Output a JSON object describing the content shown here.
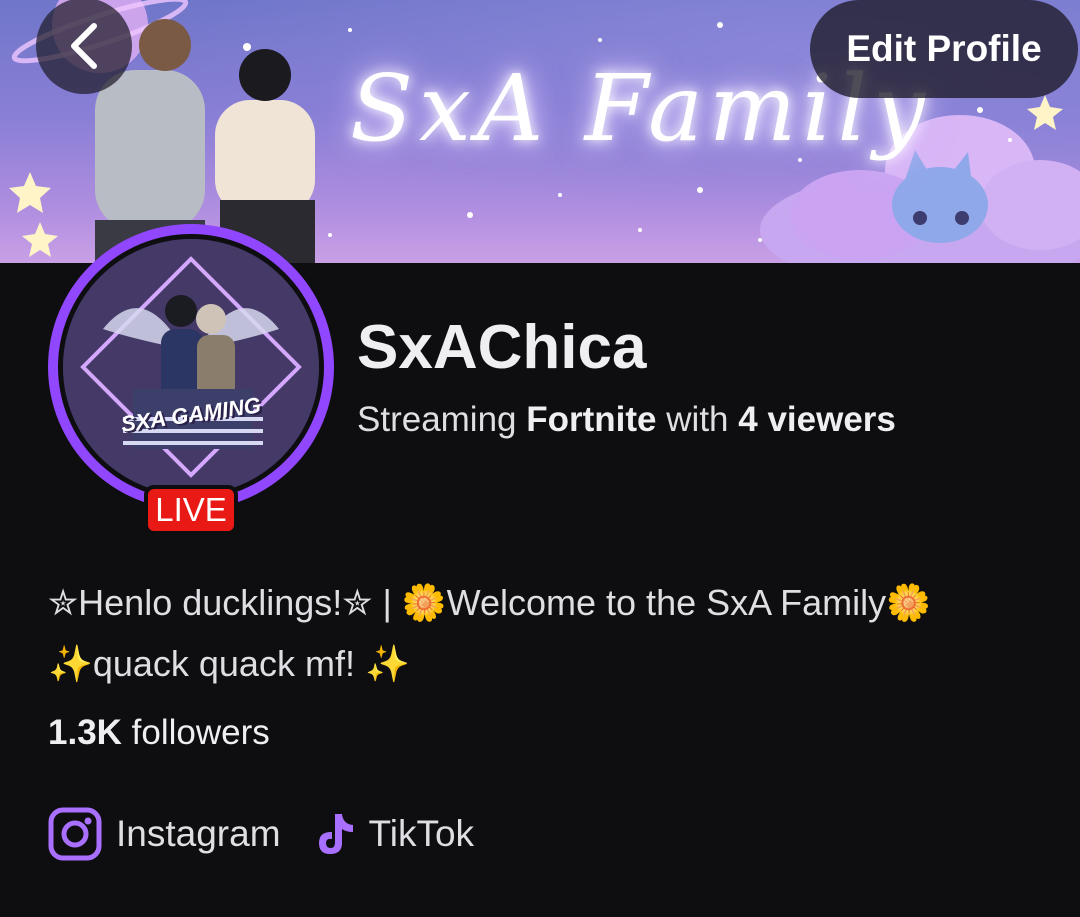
{
  "banner": {
    "title": "SxA Family"
  },
  "header": {
    "back_icon": "chevron-left-icon",
    "edit_label": "Edit Profile"
  },
  "avatar": {
    "logo_text": "SXA GAMING",
    "live_label": "LIVE",
    "ring_color": "#9147ff",
    "live_color": "#e91916"
  },
  "channel": {
    "name": "SxAChica",
    "stream_prefix": "Streaming",
    "game": "Fortnite",
    "stream_middle": "with",
    "viewers": "4 viewers"
  },
  "bio": {
    "line1": "✮Henlo ducklings!✮ | 🌼Welcome to the SxA Family🌼",
    "line2": "✨quack quack mf! ✨"
  },
  "followers": {
    "count": "1.3K",
    "label": "followers"
  },
  "socials": [
    {
      "icon": "instagram-icon",
      "label": "Instagram"
    },
    {
      "icon": "tiktok-icon",
      "label": "TikTok"
    }
  ],
  "colors": {
    "accent": "#9147ff",
    "background": "#0e0e10"
  }
}
